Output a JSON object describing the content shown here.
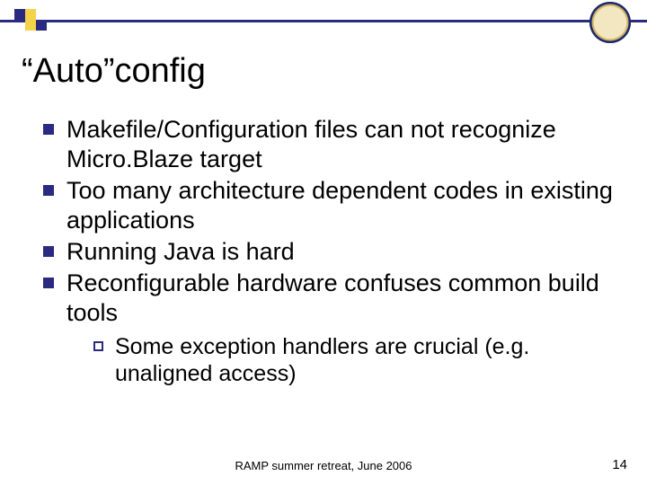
{
  "title": "“Auto”config",
  "bullets": [
    "Makefile/Configuration files can not recognize Micro.Blaze target",
    "Too many architecture dependent codes in existing applications",
    "Running Java is hard",
    "Reconfigurable hardware confuses common build tools"
  ],
  "sub_bullets": [
    "Some exception handlers are crucial (e.g. unaligned access)"
  ],
  "footer": "RAMP summer retreat, June 2006",
  "page_number": "14"
}
